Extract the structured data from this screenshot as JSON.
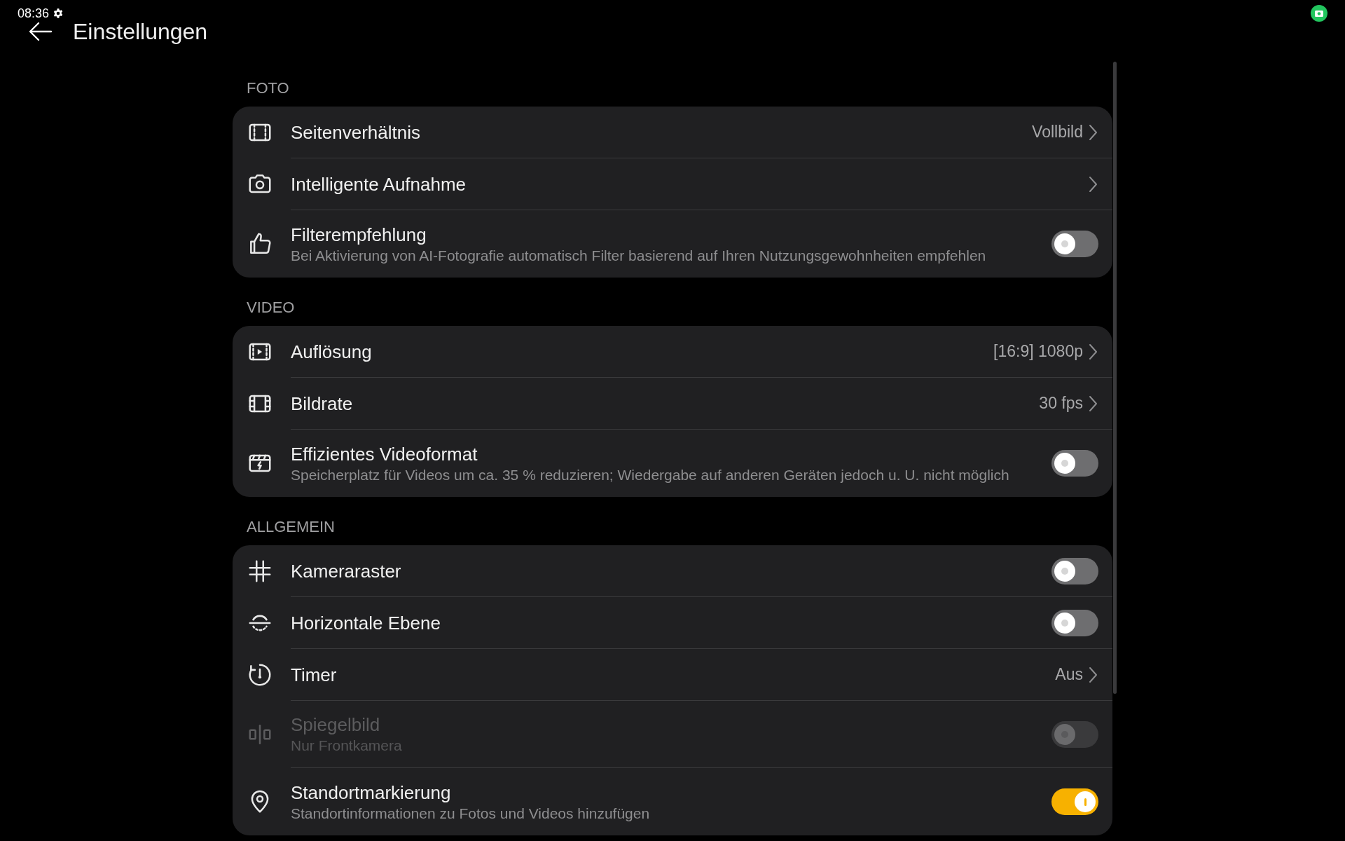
{
  "status_bar": {
    "time": "08:36"
  },
  "header": {
    "title": "Einstellungen"
  },
  "sections": [
    {
      "title": "FOTO",
      "items": [
        {
          "kind": "nav",
          "title": "Seitenverhältnis",
          "value": "Vollbild"
        },
        {
          "kind": "nav",
          "title": "Intelligente Aufnahme"
        },
        {
          "kind": "toggle",
          "title": "Filterempfehlung",
          "subtitle": "Bei Aktivierung von AI-Fotografie automatisch Filter basierend auf Ihren Nutzungsgewohnheiten empfehlen",
          "on": false,
          "disabled": false
        }
      ]
    },
    {
      "title": "VIDEO",
      "items": [
        {
          "kind": "nav",
          "title": "Auflösung",
          "value": "[16:9] 1080p"
        },
        {
          "kind": "nav",
          "title": "Bildrate",
          "value": "30 fps"
        },
        {
          "kind": "toggle",
          "title": "Effizientes Videoformat",
          "subtitle": "Speicherplatz für Videos um ca. 35 % reduzieren; Wiedergabe auf anderen Geräten jedoch u. U. nicht möglich",
          "on": false,
          "disabled": false
        }
      ]
    },
    {
      "title": "ALLGEMEIN",
      "items": [
        {
          "kind": "toggle",
          "title": "Kameraraster",
          "on": false,
          "disabled": false
        },
        {
          "kind": "toggle",
          "title": "Horizontale Ebene",
          "on": false,
          "disabled": false
        },
        {
          "kind": "nav",
          "title": "Timer",
          "value": "Aus"
        },
        {
          "kind": "toggle",
          "title": "Spiegelbild",
          "subtitle": "Nur Frontkamera",
          "on": false,
          "disabled": true
        },
        {
          "kind": "toggle",
          "title": "Standortmarkierung",
          "subtitle": "Standortinformationen zu Fotos und Videos hinzufügen",
          "on": true,
          "disabled": false
        }
      ]
    }
  ]
}
